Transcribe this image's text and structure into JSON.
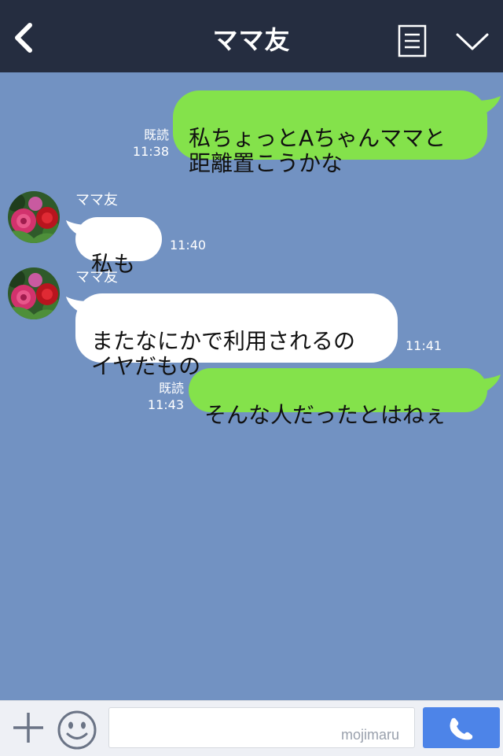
{
  "header": {
    "title": "ママ友"
  },
  "messages": [
    {
      "id": "m1",
      "direction": "out",
      "text": "私ちょっとAちゃんママと\n距離置こうかな",
      "read": "既読",
      "time": "11:38"
    },
    {
      "id": "m2",
      "direction": "in",
      "sender": "ママ友",
      "text": "私も",
      "time": "11:40"
    },
    {
      "id": "m3",
      "direction": "in",
      "sender": "ママ友",
      "text": "またなにかで利用されるの\nイヤだもの",
      "time": "11:41"
    },
    {
      "id": "m4",
      "direction": "out",
      "text": "そんな人だったとはねぇ",
      "read": "既読",
      "time": "11:43"
    }
  ],
  "input": {
    "placeholder": "",
    "watermark": "mojimaru"
  },
  "colors": {
    "header_bg": "#252d40",
    "chat_bg": "#7292c2",
    "out_bubble": "#84e24b",
    "in_bubble": "#ffffff",
    "call_button": "#4d84e8"
  },
  "icons": [
    "back-arrow-icon",
    "notes-icon",
    "chevron-down-icon",
    "plus-icon",
    "smiley-icon",
    "phone-icon"
  ]
}
